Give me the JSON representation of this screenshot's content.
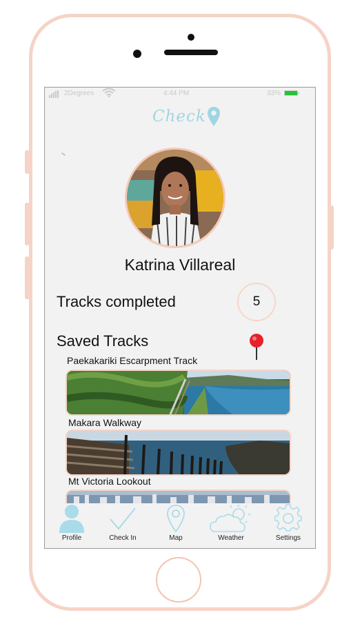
{
  "status_bar": {
    "carrier": "2Degrees",
    "time": "4:44 PM",
    "battery_percent": "33%",
    "signal_icon": "signal-bars-icon",
    "wifi_icon": "wifi-icon",
    "battery_color": "#27c13a"
  },
  "app": {
    "logo_text": "Check",
    "logo_icon": "location-pin-icon",
    "brand_color": "#9fd6e4",
    "accent_color": "#f6d3c7"
  },
  "profile": {
    "name": "Katrina Villareal",
    "tracks_completed_label": "Tracks completed",
    "tracks_completed_count": "5",
    "saved_tracks_label": "Saved Tracks",
    "saved_pin_icon": "red-map-pin-icon"
  },
  "saved_tracks": [
    {
      "name": "Paekakariki Escarpment Track"
    },
    {
      "name": "Makara Walkway"
    },
    {
      "name": "Mt Victoria Lookout"
    }
  ],
  "tab_bar": {
    "items": [
      {
        "label": "Profile",
        "icon": "person-icon",
        "active": true
      },
      {
        "label": "Check In",
        "icon": "checkmark-icon"
      },
      {
        "label": "Map",
        "icon": "map-pin-icon"
      },
      {
        "label": "Weather",
        "icon": "cloud-sun-icon"
      },
      {
        "label": "Settings",
        "icon": "gear-icon"
      }
    ]
  }
}
